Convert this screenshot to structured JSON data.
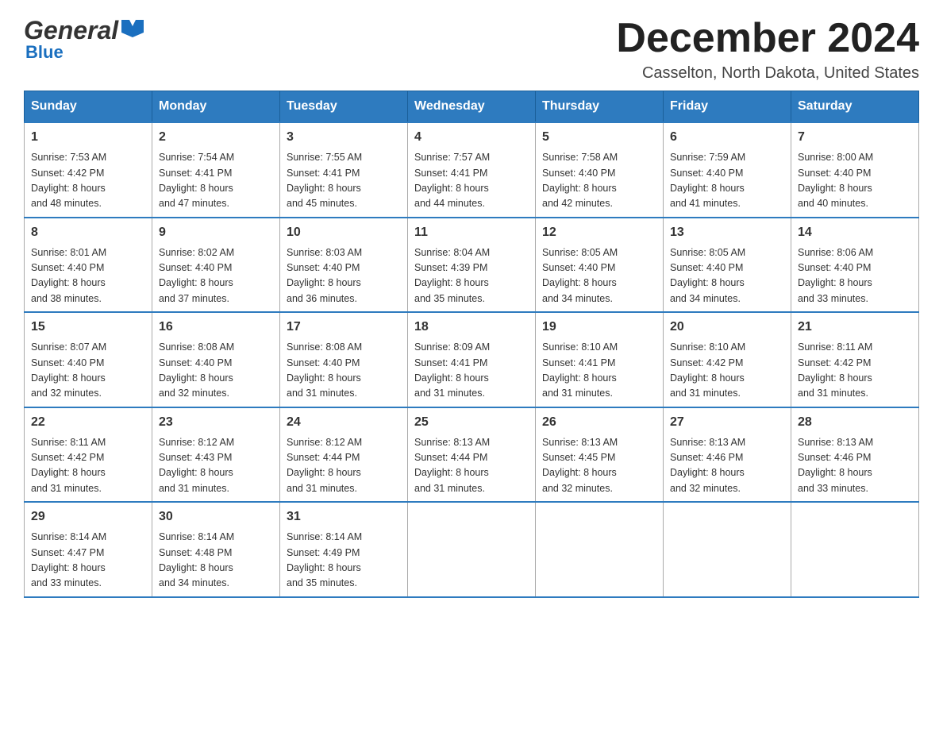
{
  "header": {
    "logo_general": "General",
    "logo_blue": "Blue",
    "month_title": "December 2024",
    "location": "Casselton, North Dakota, United States"
  },
  "calendar": {
    "days_of_week": [
      "Sunday",
      "Monday",
      "Tuesday",
      "Wednesday",
      "Thursday",
      "Friday",
      "Saturday"
    ],
    "weeks": [
      [
        {
          "day": "1",
          "sunrise": "7:53 AM",
          "sunset": "4:42 PM",
          "daylight": "8 hours and 48 minutes."
        },
        {
          "day": "2",
          "sunrise": "7:54 AM",
          "sunset": "4:41 PM",
          "daylight": "8 hours and 47 minutes."
        },
        {
          "day": "3",
          "sunrise": "7:55 AM",
          "sunset": "4:41 PM",
          "daylight": "8 hours and 45 minutes."
        },
        {
          "day": "4",
          "sunrise": "7:57 AM",
          "sunset": "4:41 PM",
          "daylight": "8 hours and 44 minutes."
        },
        {
          "day": "5",
          "sunrise": "7:58 AM",
          "sunset": "4:40 PM",
          "daylight": "8 hours and 42 minutes."
        },
        {
          "day": "6",
          "sunrise": "7:59 AM",
          "sunset": "4:40 PM",
          "daylight": "8 hours and 41 minutes."
        },
        {
          "day": "7",
          "sunrise": "8:00 AM",
          "sunset": "4:40 PM",
          "daylight": "8 hours and 40 minutes."
        }
      ],
      [
        {
          "day": "8",
          "sunrise": "8:01 AM",
          "sunset": "4:40 PM",
          "daylight": "8 hours and 38 minutes."
        },
        {
          "day": "9",
          "sunrise": "8:02 AM",
          "sunset": "4:40 PM",
          "daylight": "8 hours and 37 minutes."
        },
        {
          "day": "10",
          "sunrise": "8:03 AM",
          "sunset": "4:40 PM",
          "daylight": "8 hours and 36 minutes."
        },
        {
          "day": "11",
          "sunrise": "8:04 AM",
          "sunset": "4:39 PM",
          "daylight": "8 hours and 35 minutes."
        },
        {
          "day": "12",
          "sunrise": "8:05 AM",
          "sunset": "4:40 PM",
          "daylight": "8 hours and 34 minutes."
        },
        {
          "day": "13",
          "sunrise": "8:05 AM",
          "sunset": "4:40 PM",
          "daylight": "8 hours and 34 minutes."
        },
        {
          "day": "14",
          "sunrise": "8:06 AM",
          "sunset": "4:40 PM",
          "daylight": "8 hours and 33 minutes."
        }
      ],
      [
        {
          "day": "15",
          "sunrise": "8:07 AM",
          "sunset": "4:40 PM",
          "daylight": "8 hours and 32 minutes."
        },
        {
          "day": "16",
          "sunrise": "8:08 AM",
          "sunset": "4:40 PM",
          "daylight": "8 hours and 32 minutes."
        },
        {
          "day": "17",
          "sunrise": "8:08 AM",
          "sunset": "4:40 PM",
          "daylight": "8 hours and 31 minutes."
        },
        {
          "day": "18",
          "sunrise": "8:09 AM",
          "sunset": "4:41 PM",
          "daylight": "8 hours and 31 minutes."
        },
        {
          "day": "19",
          "sunrise": "8:10 AM",
          "sunset": "4:41 PM",
          "daylight": "8 hours and 31 minutes."
        },
        {
          "day": "20",
          "sunrise": "8:10 AM",
          "sunset": "4:42 PM",
          "daylight": "8 hours and 31 minutes."
        },
        {
          "day": "21",
          "sunrise": "8:11 AM",
          "sunset": "4:42 PM",
          "daylight": "8 hours and 31 minutes."
        }
      ],
      [
        {
          "day": "22",
          "sunrise": "8:11 AM",
          "sunset": "4:42 PM",
          "daylight": "8 hours and 31 minutes."
        },
        {
          "day": "23",
          "sunrise": "8:12 AM",
          "sunset": "4:43 PM",
          "daylight": "8 hours and 31 minutes."
        },
        {
          "day": "24",
          "sunrise": "8:12 AM",
          "sunset": "4:44 PM",
          "daylight": "8 hours and 31 minutes."
        },
        {
          "day": "25",
          "sunrise": "8:13 AM",
          "sunset": "4:44 PM",
          "daylight": "8 hours and 31 minutes."
        },
        {
          "day": "26",
          "sunrise": "8:13 AM",
          "sunset": "4:45 PM",
          "daylight": "8 hours and 32 minutes."
        },
        {
          "day": "27",
          "sunrise": "8:13 AM",
          "sunset": "4:46 PM",
          "daylight": "8 hours and 32 minutes."
        },
        {
          "day": "28",
          "sunrise": "8:13 AM",
          "sunset": "4:46 PM",
          "daylight": "8 hours and 33 minutes."
        }
      ],
      [
        {
          "day": "29",
          "sunrise": "8:14 AM",
          "sunset": "4:47 PM",
          "daylight": "8 hours and 33 minutes."
        },
        {
          "day": "30",
          "sunrise": "8:14 AM",
          "sunset": "4:48 PM",
          "daylight": "8 hours and 34 minutes."
        },
        {
          "day": "31",
          "sunrise": "8:14 AM",
          "sunset": "4:49 PM",
          "daylight": "8 hours and 35 minutes."
        },
        null,
        null,
        null,
        null
      ]
    ],
    "sunrise_label": "Sunrise:",
    "sunset_label": "Sunset:",
    "daylight_label": "Daylight:"
  }
}
